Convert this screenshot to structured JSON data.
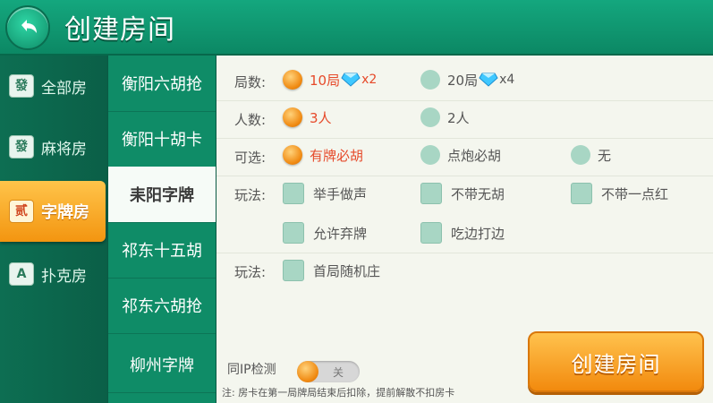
{
  "header": {
    "title": "创建房间"
  },
  "categories": [
    {
      "label": "全部房",
      "icon": "mahjong-tile-icon"
    },
    {
      "label": "麻将房",
      "icon": "mahjong-tile-icon"
    },
    {
      "label": "字牌房",
      "icon": "paper-cards-icon",
      "active": true
    },
    {
      "label": "扑克房",
      "icon": "poker-cards-icon"
    }
  ],
  "games": [
    {
      "label": "衡阳六胡抢"
    },
    {
      "label": "衡阳十胡卡"
    },
    {
      "label": "耒阳字牌",
      "active": true
    },
    {
      "label": "祁东十五胡"
    },
    {
      "label": "祁东六胡抢"
    },
    {
      "label": "柳州字牌"
    }
  ],
  "options": {
    "rounds": {
      "label": "局数:",
      "choices": [
        {
          "text": "10局",
          "mult": "x2",
          "selected": true
        },
        {
          "text": "20局",
          "mult": "x4",
          "selected": false
        }
      ]
    },
    "players": {
      "label": "人数:",
      "choices": [
        {
          "text": "3人",
          "selected": true
        },
        {
          "text": "2人",
          "selected": false
        }
      ]
    },
    "optional": {
      "label": "可选:",
      "choices": [
        {
          "text": "有牌必胡",
          "selected": true
        },
        {
          "text": "点炮必胡",
          "selected": false
        },
        {
          "text": "无",
          "selected": false
        }
      ]
    },
    "play1": {
      "label": "玩法:",
      "choices": [
        {
          "text": "举手做声",
          "checked": false
        },
        {
          "text": "不带无胡",
          "checked": false
        },
        {
          "text": "不带一点红",
          "checked": false
        },
        {
          "text": "允许弃牌",
          "checked": false
        },
        {
          "text": "吃边打边",
          "checked": false
        }
      ]
    },
    "play2": {
      "label": "玩法:",
      "choices": [
        {
          "text": "首局随机庄",
          "checked": false
        }
      ]
    }
  },
  "ip_check": {
    "label": "同IP检测",
    "state": "关",
    "enabled": false
  },
  "note": "注: 房卡在第一局牌局结束后扣除，提前解散不扣房卡",
  "create_button": {
    "label": "创建房间"
  },
  "colors": {
    "selected_text": "#e64a2a",
    "accent": "#f39510",
    "theme": "#0f8c67"
  }
}
